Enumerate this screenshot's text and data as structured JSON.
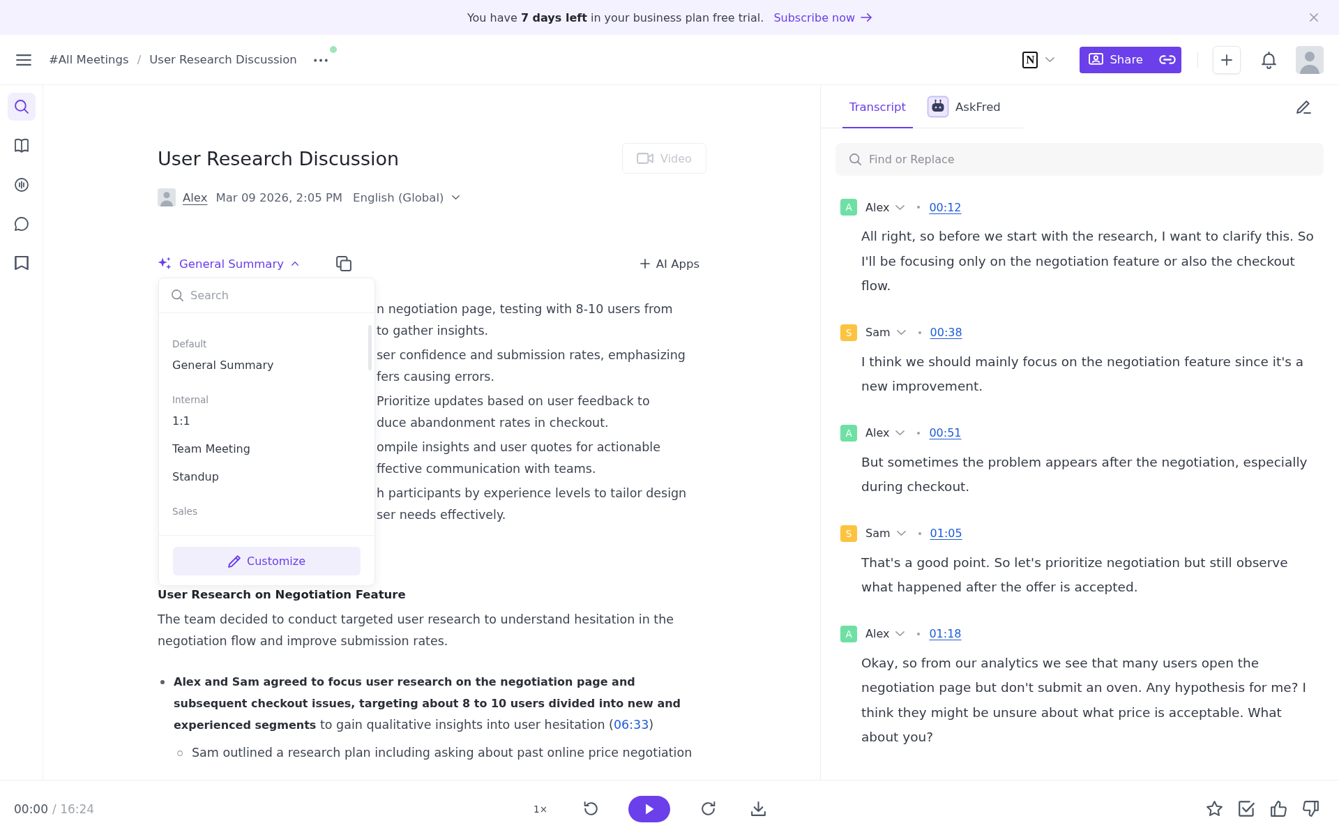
{
  "banner": {
    "message": "You have **7 days left** in your business plan free trial.",
    "link": "Subscribe now"
  },
  "header": {
    "breadcrumbs": [
      "#All Meetings",
      "User Research Discussion"
    ],
    "separator": "/",
    "integration_logo": "N",
    "share": "Share"
  },
  "sidebar": {
    "items": [
      {
        "selected": true
      },
      {
        "selected": false
      },
      {
        "selected": false
      },
      {
        "selected": false
      },
      {
        "selected": false
      }
    ]
  },
  "meeting": {
    "title": "User Research Discussion",
    "video": {
      "label": "Video",
      "disabled": true
    },
    "author": "Alex",
    "date": "Mar 09 2026, 2:05 PM",
    "language": "English (Global)"
  },
  "summary": {
    "template": "General Summary",
    "expanded": true,
    "ai_apps": "AI Apps",
    "menu": {
      "search_placeholder": "Search",
      "groups": [
        {
          "label": "Default",
          "items": [
            {
              "label": "General Summary",
              "selected": false
            }
          ]
        },
        {
          "label": "Internal",
          "items": [
            {
              "label": "1:1",
              "selected": false
            },
            {
              "label": "Team Meeting",
              "selected": false
            },
            {
              "label": "Standup",
              "selected": false
            }
          ]
        },
        {
          "label": "Sales"
        }
      ],
      "customize": "Customize"
    },
    "overview": [
      {
        "lines": [
          "n negotiation page, testing with 8-10 users from",
          "to gather insights."
        ]
      },
      {
        "lines": [
          "ser confidence and submission rates, emphasizing",
          "fers causing errors."
        ]
      },
      {
        "lines": [
          "Prioritize updates based on user feedback to",
          "duce abandonment rates in checkout."
        ]
      },
      {
        "lines": [
          "ompile insights and user quotes for actionable",
          "ffective communication with teams."
        ]
      },
      {
        "lines": [
          "h participants by experience levels to tailor design",
          "ser needs effectively."
        ]
      }
    ],
    "sections": [
      {
        "heading": "User Research on Negotiation Feature",
        "paragraph": "The team decided to conduct targeted user research to understand hesitation in the negotiation flow and improve submission rates.",
        "bullets": [
          {
            "text": "**Alex and Sam agreed to focus user research on the negotiation page and subsequent checkout issues, targeting about 8 to 10 users divided into new and experienced segments** to gain qualitative insights into user hesitation (",
            "timestamp": "06:33",
            "text_after": ")",
            "children": [
              {
                "text": "Sam outlined a research plan including asking about past online price negotiation"
              }
            ]
          }
        ]
      }
    ]
  },
  "transcript": {
    "tabs": [
      {
        "label": "Transcript",
        "selected": true,
        "kind": "text"
      },
      {
        "label": "AskFred",
        "selected": false,
        "kind": "assistant"
      }
    ],
    "search_placeholder": "Find or Replace",
    "entries": [
      {
        "initial": "A",
        "speaker": "Alex",
        "color": "#6ee0a4",
        "time": "00:12",
        "text": "All right, so before we start with the research, I want to clarify this. So I'll be focusing only on the negotiation feature or also the checkout flow."
      },
      {
        "initial": "S",
        "speaker": "Sam",
        "color": "#fcc340",
        "time": "00:38",
        "text": "I think we should mainly focus on the negotiation feature since it's a new improvement."
      },
      {
        "initial": "A",
        "speaker": "Alex",
        "color": "#6ee0a4",
        "time": "00:51",
        "text": "But sometimes the problem appears after the negotiation, especially during checkout."
      },
      {
        "initial": "S",
        "speaker": "Sam",
        "color": "#fcc340",
        "time": "01:05",
        "text": "That's a good point. So let's prioritize negotiation but still observe what happened after the offer is accepted."
      },
      {
        "initial": "A",
        "speaker": "Alex",
        "color": "#6ee0a4",
        "time": "01:18",
        "text": "Okay, so from our analytics we see that many users open the negotiation page but don't submit an oven. Any hypothesis for me? I think they might be unsure about what price is acceptable. What about you?"
      }
    ]
  },
  "player": {
    "current_time": "00:00",
    "total_time": "/ 16:24",
    "speed": "1×"
  }
}
